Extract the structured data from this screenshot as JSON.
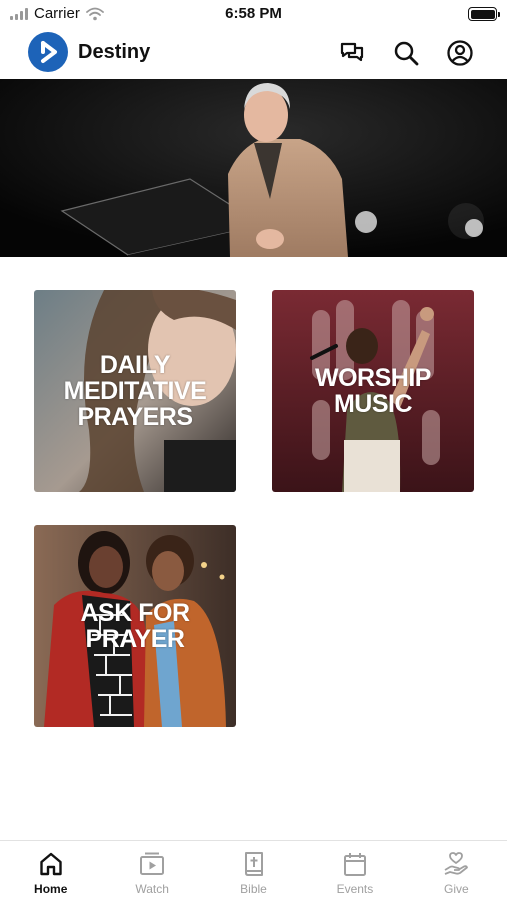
{
  "status_bar": {
    "carrier": "Carrier",
    "time": "6:58 PM"
  },
  "header": {
    "title": "Destiny"
  },
  "tiles": [
    {
      "label": "DAILY MEDITATIVE PRAYERS"
    },
    {
      "label": "WORSHIP MUSIC"
    },
    {
      "label": "ASK FOR PRAYER"
    }
  ],
  "tab_bar": {
    "items": [
      {
        "label": "Home",
        "icon": "home-icon",
        "active": true
      },
      {
        "label": "Watch",
        "icon": "watch-icon",
        "active": false
      },
      {
        "label": "Bible",
        "icon": "bible-icon",
        "active": false
      },
      {
        "label": "Events",
        "icon": "calendar-icon",
        "active": false
      },
      {
        "label": "Give",
        "icon": "give-icon",
        "active": false
      }
    ]
  },
  "colors": {
    "brand": "#1d63b8",
    "active_tab": "#111111",
    "inactive_tab": "#a0a0a0"
  }
}
